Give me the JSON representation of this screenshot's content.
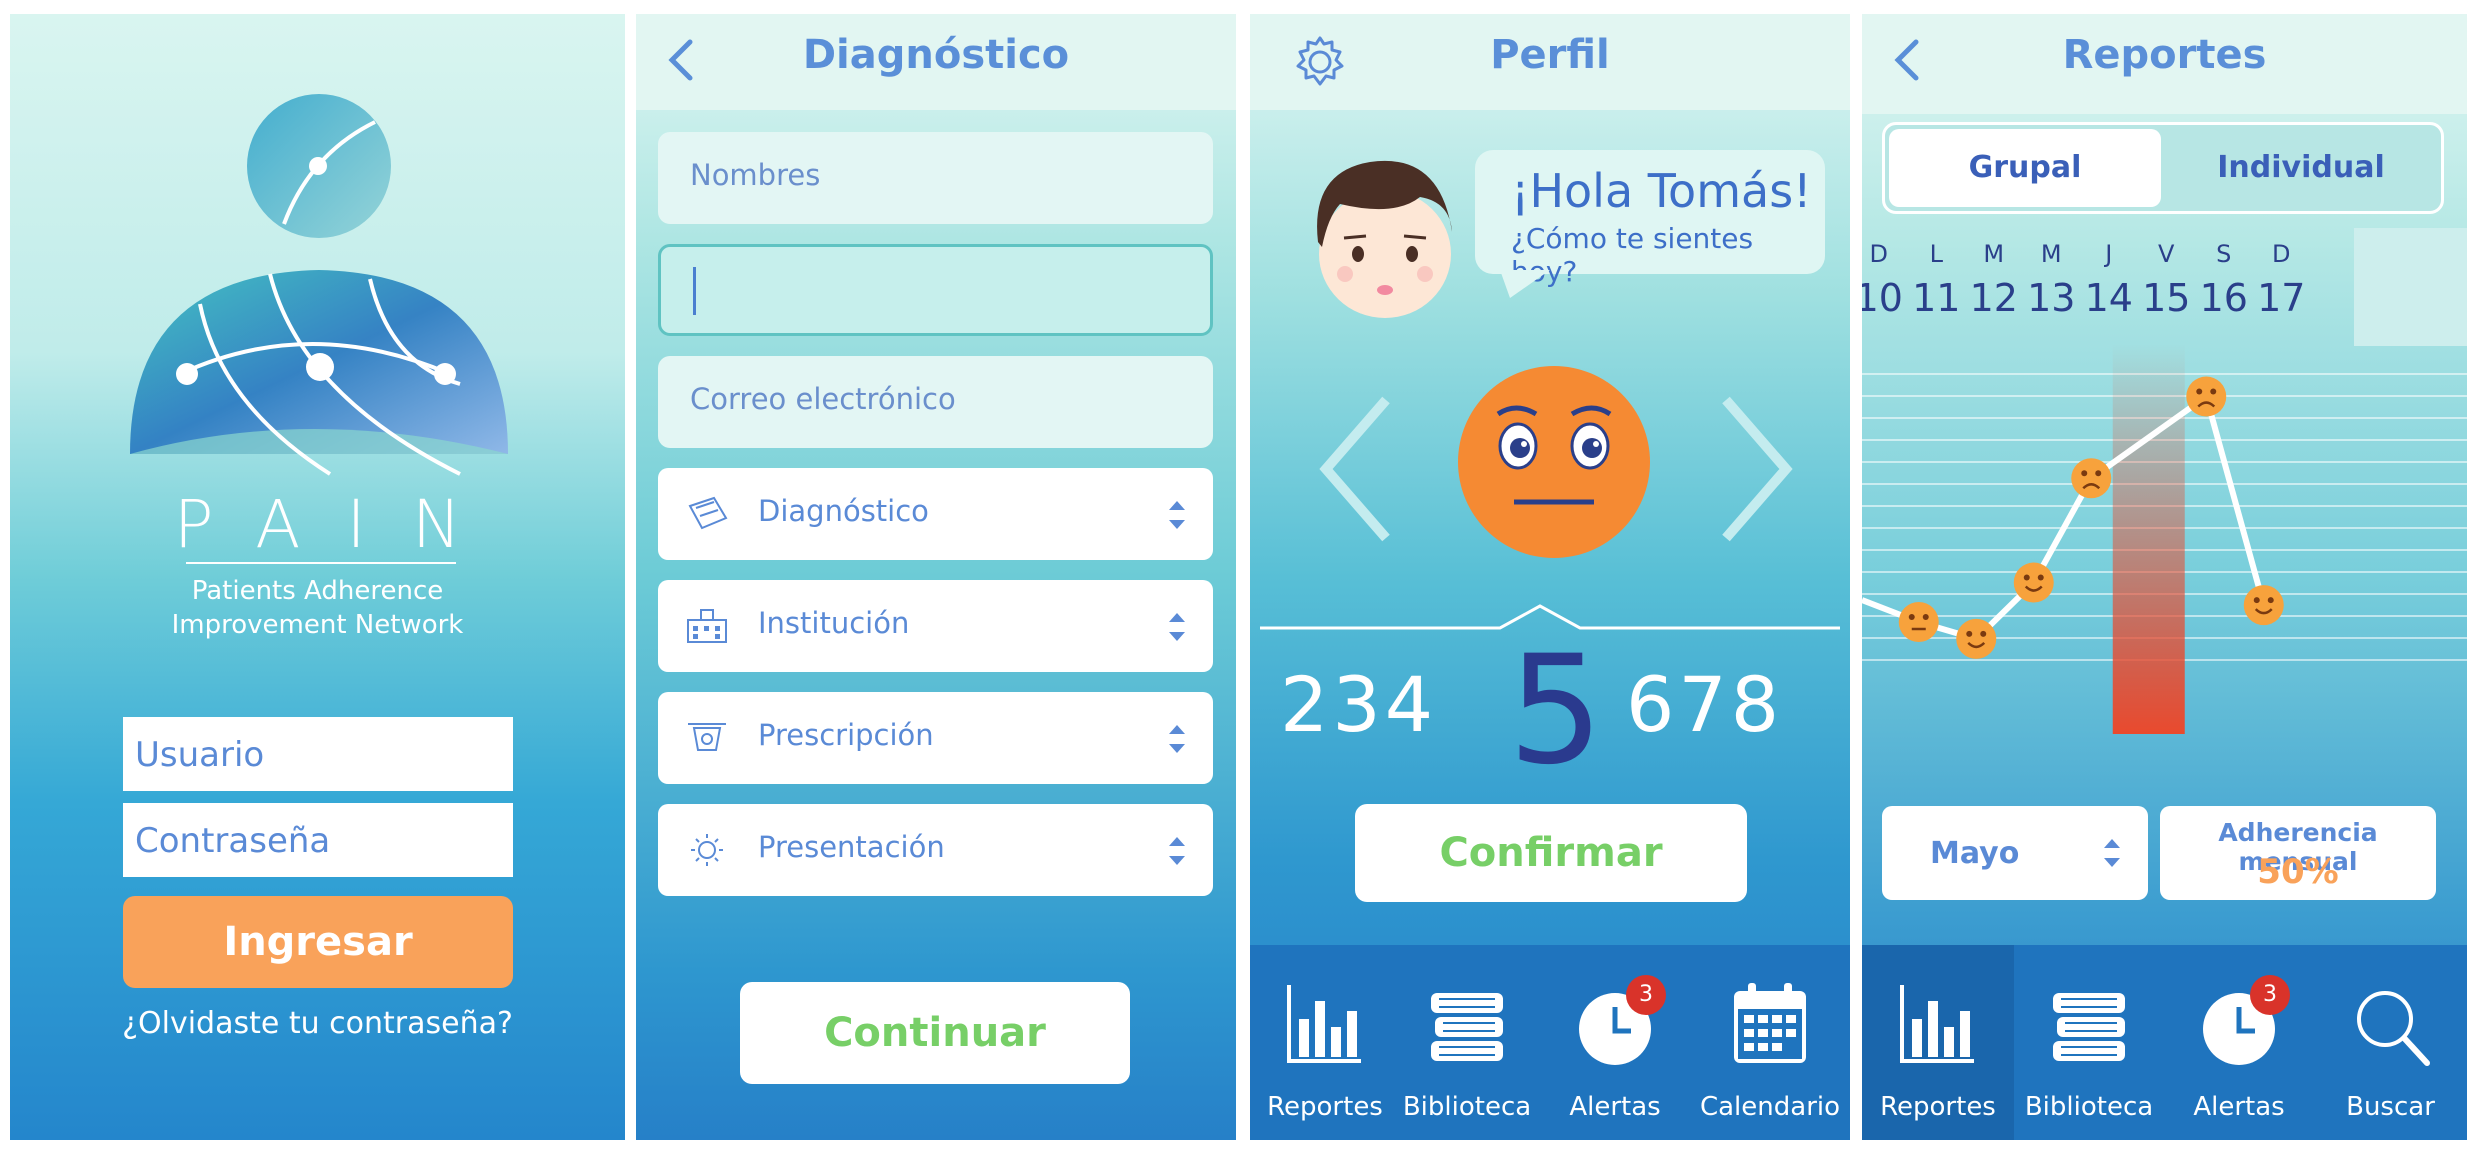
{
  "login": {
    "logo_text": "PAIN",
    "subtitle_line1": "Patients Adherence",
    "subtitle_line2": "Improvement Network",
    "username_placeholder": "Usuario",
    "password_placeholder": "Contraseña",
    "login_button": "Ingresar",
    "forgot_link": "¿Olvidaste tu contraseña?"
  },
  "diagnostico": {
    "title": "Diagnóstico",
    "names_placeholder": "Nombres",
    "email_placeholder": "Correo electrónico",
    "selects": [
      {
        "label": "Diagnóstico",
        "icon": "clipboard-icon"
      },
      {
        "label": "Institución",
        "icon": "building-icon"
      },
      {
        "label": "Prescripción",
        "icon": "scale-icon"
      },
      {
        "label": "Presentación",
        "icon": "sun-icon"
      }
    ],
    "continue_button": "Continuar"
  },
  "perfil": {
    "title": "Perfil",
    "greeting": "¡Hola Tomás!",
    "question": "¿Cómo te sientes hoy?",
    "scale_left": "234",
    "scale_selected": "5",
    "scale_right": "678",
    "selected_value": 5,
    "confirm_button": "Confirmar",
    "tabs": [
      {
        "label": "Reportes",
        "icon": "bar-chart-icon"
      },
      {
        "label": "Biblioteca",
        "icon": "books-icon"
      },
      {
        "label": "Alertas",
        "icon": "clock-icon",
        "badge": "3"
      },
      {
        "label": "Calendario",
        "icon": "calendar-icon"
      }
    ]
  },
  "reportes": {
    "title": "Reportes",
    "segment": [
      "Grupal",
      "Individual"
    ],
    "days": [
      {
        "letter": "D",
        "num": "10"
      },
      {
        "letter": "L",
        "num": "11"
      },
      {
        "letter": "M",
        "num": "12"
      },
      {
        "letter": "M",
        "num": "13"
      },
      {
        "letter": "J",
        "num": "14"
      },
      {
        "letter": "V",
        "num": "15"
      },
      {
        "letter": "S",
        "num": "16"
      },
      {
        "letter": "D",
        "num": "17"
      }
    ],
    "month_select": "Mayo",
    "adherence_label": "Adherencia mensual",
    "adherence_value": "50%",
    "tabs": [
      {
        "label": "Reportes",
        "icon": "bar-chart-icon"
      },
      {
        "label": "Biblioteca",
        "icon": "books-icon"
      },
      {
        "label": "Alertas",
        "icon": "clock-icon",
        "badge": "3"
      },
      {
        "label": "Buscar",
        "icon": "search-icon"
      }
    ]
  },
  "chart_data": {
    "type": "line",
    "x": [
      "10",
      "11",
      "12",
      "13",
      "14",
      "15",
      "16"
    ],
    "mood": [
      "neutral",
      "happy",
      "happy",
      "sad",
      null,
      "sad",
      "happy"
    ],
    "series": [
      {
        "values": [
          2.2,
          1.6,
          3.6,
          7.3,
          null,
          10.2,
          2.8
        ]
      }
    ],
    "highlight_day": "14",
    "grid": true
  },
  "colors": {
    "accent_orange": "#f9a25a",
    "confirm_green": "#77cf67",
    "title_blue": "#5a8fd8",
    "tabbar_blue": "#1f74be",
    "badge_red": "#d9332a",
    "face_orange": "#f58a33"
  }
}
